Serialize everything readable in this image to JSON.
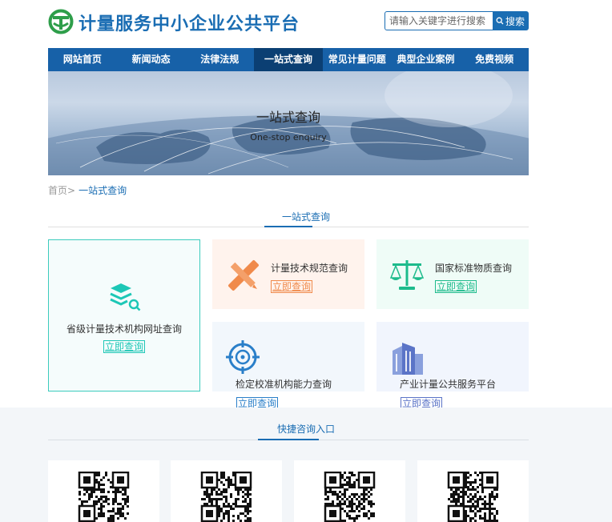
{
  "header": {
    "title": "计量服务中小企业公共平台",
    "search": {
      "placeholder": "请输入关键字进行搜索",
      "button_label": "搜索"
    }
  },
  "nav": {
    "items": [
      {
        "label": "网站首页"
      },
      {
        "label": "新闻动态"
      },
      {
        "label": "法律法规"
      },
      {
        "label": "一站式查询",
        "active": true
      },
      {
        "label": "常见计量问题"
      },
      {
        "label": "典型企业案例"
      },
      {
        "label": "免费视频"
      }
    ]
  },
  "banner": {
    "title": "一站式查询",
    "subtitle": "One-stop enquiry"
  },
  "breadcrumb": {
    "home": "首页",
    "separator": ">",
    "current": "一站式查询"
  },
  "section_query": {
    "title": "一站式查询"
  },
  "cards": [
    {
      "label": "省级计量技术机构网址查询",
      "button": "立即查询",
      "icon": "stack-search-icon",
      "color": "#1dc7b6"
    },
    {
      "label": "计量技术规范查询",
      "button": "立即查询",
      "icon": "ruler-pencil-icon",
      "color": "#f08a4b"
    },
    {
      "label": "国家标准物质查询",
      "button": "立即查询",
      "icon": "scales-icon",
      "color": "#1dbb8c"
    },
    {
      "label": "检定校准机构能力查询",
      "button": "立即查询",
      "icon": "target-icon",
      "color": "#2a7fc9"
    },
    {
      "label": "产业计量公共服务平台",
      "button": "立即查询",
      "icon": "buildings-icon",
      "color": "#5b74c7"
    }
  ],
  "section_consult": {
    "title": "快捷咨询入口"
  },
  "qr_codes": [
    {
      "icon": "qr-code-icon"
    },
    {
      "icon": "qr-code-icon"
    },
    {
      "icon": "qr-code-icon"
    },
    {
      "icon": "qr-code-icon"
    }
  ],
  "colors": {
    "brand": "#1a6db3",
    "nav": "#1761a8",
    "nav_active": "#0b3f73",
    "logo": "#2e9e4a"
  }
}
